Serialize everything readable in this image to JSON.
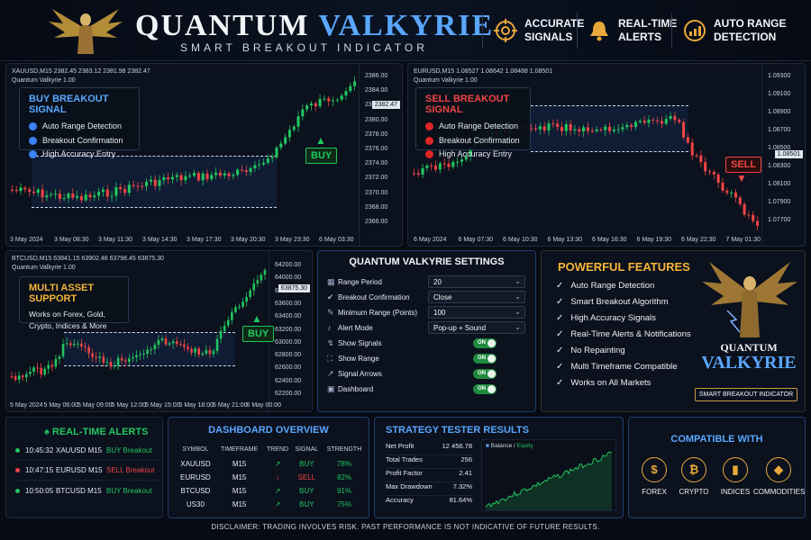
{
  "header": {
    "title_part1": "QUANTUM",
    "title_part2": "VALKYRIE",
    "subtitle": "SMART BREAKOUT INDICATOR",
    "features": [
      {
        "icon": "target-icon",
        "line1": "ACCURATE",
        "line2": "SIGNALS"
      },
      {
        "icon": "bell-icon",
        "line1": "REAL-TIME",
        "line2": "ALERTS"
      },
      {
        "icon": "range-chart-icon",
        "line1": "AUTO RANGE",
        "line2": "DETECTION"
      }
    ]
  },
  "colors": {
    "buy": "#22c55e",
    "sell": "#ef4444",
    "accent_blue": "#5aa7ff",
    "gold": "#f5b537"
  },
  "chart_xau": {
    "symbol_line": "XAUUSD,M15  2382.45 2383.12 2381.98 2382.47",
    "indicator_line": "Quantum Valkyrie 1.00",
    "price_tag": "2382.47",
    "yticks": [
      "2386.00",
      "2384.00",
      "2382.00",
      "2380.00",
      "2378.00",
      "2376.00",
      "2374.00",
      "2372.00",
      "2370.00",
      "2368.00",
      "2366.00"
    ],
    "xticks": [
      "3 May 2024",
      "3 May 08:30",
      "3 May 11:30",
      "3 May 14:30",
      "3 May 17:30",
      "3 May 20:30",
      "3 May 23:30",
      "6 May 03:30"
    ],
    "box_title": "BUY BREAKOUT SIGNAL",
    "box_items": [
      "Auto Range Detection",
      "Breakout Confirmation",
      "High Accuracy Entry"
    ],
    "signal_label": "BUY"
  },
  "chart_eur": {
    "symbol_line": "EURUSD,M15  1.08527 1.08642 1.08488 1.08501",
    "indicator_line": "Quantum Valkyrie 1.00",
    "price_tag": "1.08501",
    "yticks": [
      "1.09300",
      "1.09100",
      "1.08900",
      "1.08700",
      "1.08500",
      "1.08300",
      "1.08100",
      "1.07900",
      "1.07700"
    ],
    "xticks": [
      "6 May 2024",
      "6 May 07:30",
      "6 May 10:30",
      "6 May 13:30",
      "6 May 16:30",
      "6 May 19:30",
      "6 May 22:30",
      "7 May 01:30"
    ],
    "box_title": "SELL BREAKOUT SIGNAL",
    "box_items": [
      "Auto Range Detection",
      "Breakout Confirmation",
      "High Accuracy Entry"
    ],
    "signal_label": "SELL"
  },
  "chart_btc": {
    "symbol_line": "BTCUSD,M15  63841.15 63902.48 63798.45 63875.30",
    "indicator_line": "Quantum Valkyrie 1.00",
    "price_tag": "63875.30",
    "yticks": [
      "64200.00",
      "64000.00",
      "63800.00",
      "63600.00",
      "63400.00",
      "63200.00",
      "63000.00",
      "62800.00",
      "62600.00",
      "62400.00",
      "62200.00"
    ],
    "xticks": [
      "5 May 2024",
      "5 May 06:00",
      "5 May 09:00",
      "5 May 12:00",
      "5 May 15:00",
      "5 May 18:00",
      "5 May 21:00",
      "6 May 00:00"
    ],
    "box_title": "MULTI ASSET SUPPORT",
    "box_text": [
      "Works on Forex, Gold,",
      "Crypto, Indices & More"
    ],
    "signal_label": "BUY"
  },
  "settings": {
    "title": "QUANTUM VALKYRIE SETTINGS",
    "selects": [
      {
        "icon": "grid-icon",
        "label": "Range Period",
        "value": "20"
      },
      {
        "icon": "check-shield-icon",
        "label": "Breakout Confirmation",
        "value": "Close"
      },
      {
        "icon": "ruler-icon",
        "label": "Minimum Range (Points)",
        "value": "100"
      },
      {
        "icon": "bell-icon",
        "label": "Alert Mode",
        "value": "Pop-up + Sound"
      }
    ],
    "toggles": [
      {
        "icon": "signal-icon",
        "label": "Show Signals",
        "value": "ON"
      },
      {
        "icon": "range-icon",
        "label": "Show Range",
        "value": "ON"
      },
      {
        "icon": "arrow-icon",
        "label": "Signal Arrows",
        "value": "ON"
      },
      {
        "icon": "dashboard-icon",
        "label": "Dashboard",
        "value": "ON"
      }
    ]
  },
  "features": {
    "title": "POWERFUL FEATURES",
    "items": [
      "Auto Range Detection",
      "Smart Breakout Algorithm",
      "High Accuracy Signals",
      "Real-Time Alerts & Notifications",
      "No Repainting",
      "Multi Timeframe Compatible",
      "Works on All Markets"
    ],
    "logo_line1": "QUANTUM",
    "logo_line2": "VALKYRIE",
    "logo_tag": "SMART BREAKOUT INDICATOR"
  },
  "alerts": {
    "title": "REAL-TIME ALERTS",
    "rows": [
      {
        "time": "10:45:32",
        "pair": "XAUUSD M15",
        "signal": "BUY Breakout",
        "type": "buy"
      },
      {
        "time": "10:47:15",
        "pair": "EURUSD M15",
        "signal": "SELL Breakout",
        "type": "sell"
      },
      {
        "time": "10:50:05",
        "pair": "BTCUSD M15",
        "signal": "BUY Breakout",
        "type": "buy"
      }
    ]
  },
  "dashboard": {
    "title": "DASHBOARD OVERVIEW",
    "headers": [
      "SYMBOL",
      "TIMEFRAME",
      "TREND",
      "SIGNAL",
      "STRENGTH"
    ],
    "rows": [
      {
        "symbol": "XAUUSD",
        "tf": "M15",
        "trend": "↗",
        "signal": "BUY",
        "strength": "78%",
        "type": "buy"
      },
      {
        "symbol": "EURUSD",
        "tf": "M15",
        "trend": "↓",
        "signal": "SELL",
        "strength": "82%",
        "type": "sell"
      },
      {
        "symbol": "BTCUSD",
        "tf": "M15",
        "trend": "↗",
        "signal": "BUY",
        "strength": "91%",
        "type": "buy"
      },
      {
        "symbol": "US30",
        "tf": "M15",
        "trend": "↗",
        "signal": "BUY",
        "strength": "75%",
        "type": "buy"
      }
    ]
  },
  "tester": {
    "title": "STRATEGY TESTER RESULTS",
    "rows": [
      {
        "label": "Net Profit",
        "value": "12 456.78"
      },
      {
        "label": "Total Trades",
        "value": "256"
      },
      {
        "label": "Profit Factor",
        "value": "2.41"
      },
      {
        "label": "Max Drawdown",
        "value": "7.32%"
      },
      {
        "label": "Accuracy",
        "value": "81.64%"
      }
    ],
    "legend_balance": "Balance",
    "legend_equity": "Equity"
  },
  "compatible": {
    "title": "COMPATIBLE WITH",
    "items": [
      {
        "icon": "dollar-icon",
        "glyph": "$",
        "label": "FOREX"
      },
      {
        "icon": "bitcoin-icon",
        "glyph": "₿",
        "label": "CRYPTO"
      },
      {
        "icon": "bar-chart-icon",
        "glyph": "▮",
        "label": "INDICES"
      },
      {
        "icon": "oil-drop-icon",
        "glyph": "◆",
        "label": "COMMODITIES"
      }
    ]
  },
  "disclaimer": "DISCLAIMER: TRADING INVOLVES RISK. PAST PERFORMANCE IS NOT INDICATIVE OF FUTURE RESULTS."
}
